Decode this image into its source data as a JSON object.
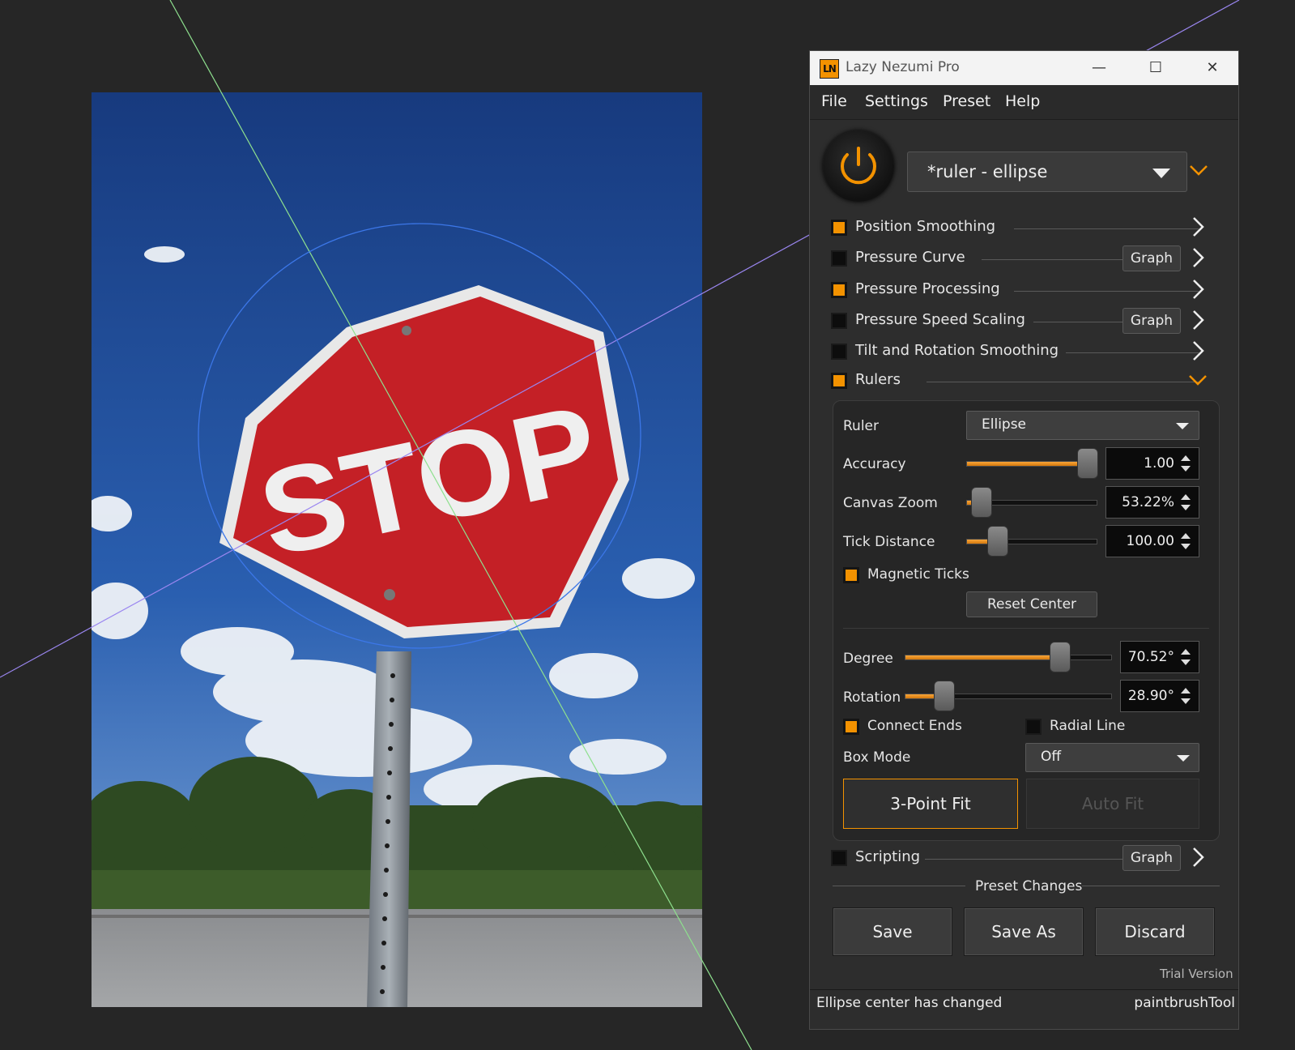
{
  "window": {
    "title": "Lazy Nezumi Pro",
    "logo_text": "LN",
    "controls": {
      "minimize": "—",
      "maximize": "☐",
      "close": "✕"
    }
  },
  "menu": [
    "File",
    "Settings",
    "Preset",
    "Help"
  ],
  "preset": {
    "name": "*ruler - ellipse"
  },
  "sections": [
    {
      "label": "Position Smoothing",
      "checked": true,
      "graph": false
    },
    {
      "label": "Pressure Curve",
      "checked": false,
      "graph": true
    },
    {
      "label": "Pressure Processing",
      "checked": true,
      "graph": false
    },
    {
      "label": "Pressure Speed Scaling",
      "checked": false,
      "graph": true
    },
    {
      "label": "Tilt and Rotation Smoothing",
      "checked": false,
      "graph": false
    },
    {
      "label": "Rulers",
      "checked": true,
      "graph": false,
      "expanded": true
    }
  ],
  "graph_label": "Graph",
  "rulers": {
    "ruler_label": "Ruler",
    "ruler_value": "Ellipse",
    "accuracy": {
      "label": "Accuracy",
      "value": "1.00",
      "fraction": 0.93
    },
    "canvas_zoom": {
      "label": "Canvas Zoom",
      "value": "53.22%",
      "fraction": 0.11
    },
    "tick_distance": {
      "label": "Tick Distance",
      "value": "100.00",
      "fraction": 0.24
    },
    "magnetic_ticks": {
      "label": "Magnetic Ticks",
      "checked": true
    },
    "reset_center": "Reset Center",
    "degree": {
      "label": "Degree",
      "value": "70.52°",
      "fraction": 0.75
    },
    "rotation": {
      "label": "Rotation",
      "value": "28.90°",
      "fraction": 0.19
    },
    "connect_ends": {
      "label": "Connect Ends",
      "checked": true
    },
    "radial_line": {
      "label": "Radial Line",
      "checked": false
    },
    "box_mode_label": "Box Mode",
    "box_mode_value": "Off",
    "three_point_fit": "3-Point Fit",
    "auto_fit": "Auto Fit"
  },
  "scripting": {
    "label": "Scripting",
    "checked": false
  },
  "preset_changes": {
    "label": "Preset Changes",
    "save": "Save",
    "save_as": "Save As",
    "discard": "Discard"
  },
  "trial": "Trial Version",
  "status": {
    "message": "Ellipse center has changed",
    "tool": "paintbrushTool"
  },
  "colors": {
    "accent": "#f39200",
    "background": "#262626",
    "panel": "#2d2d2d",
    "sky": "#1d3f86",
    "sign_red": "#c42026"
  }
}
